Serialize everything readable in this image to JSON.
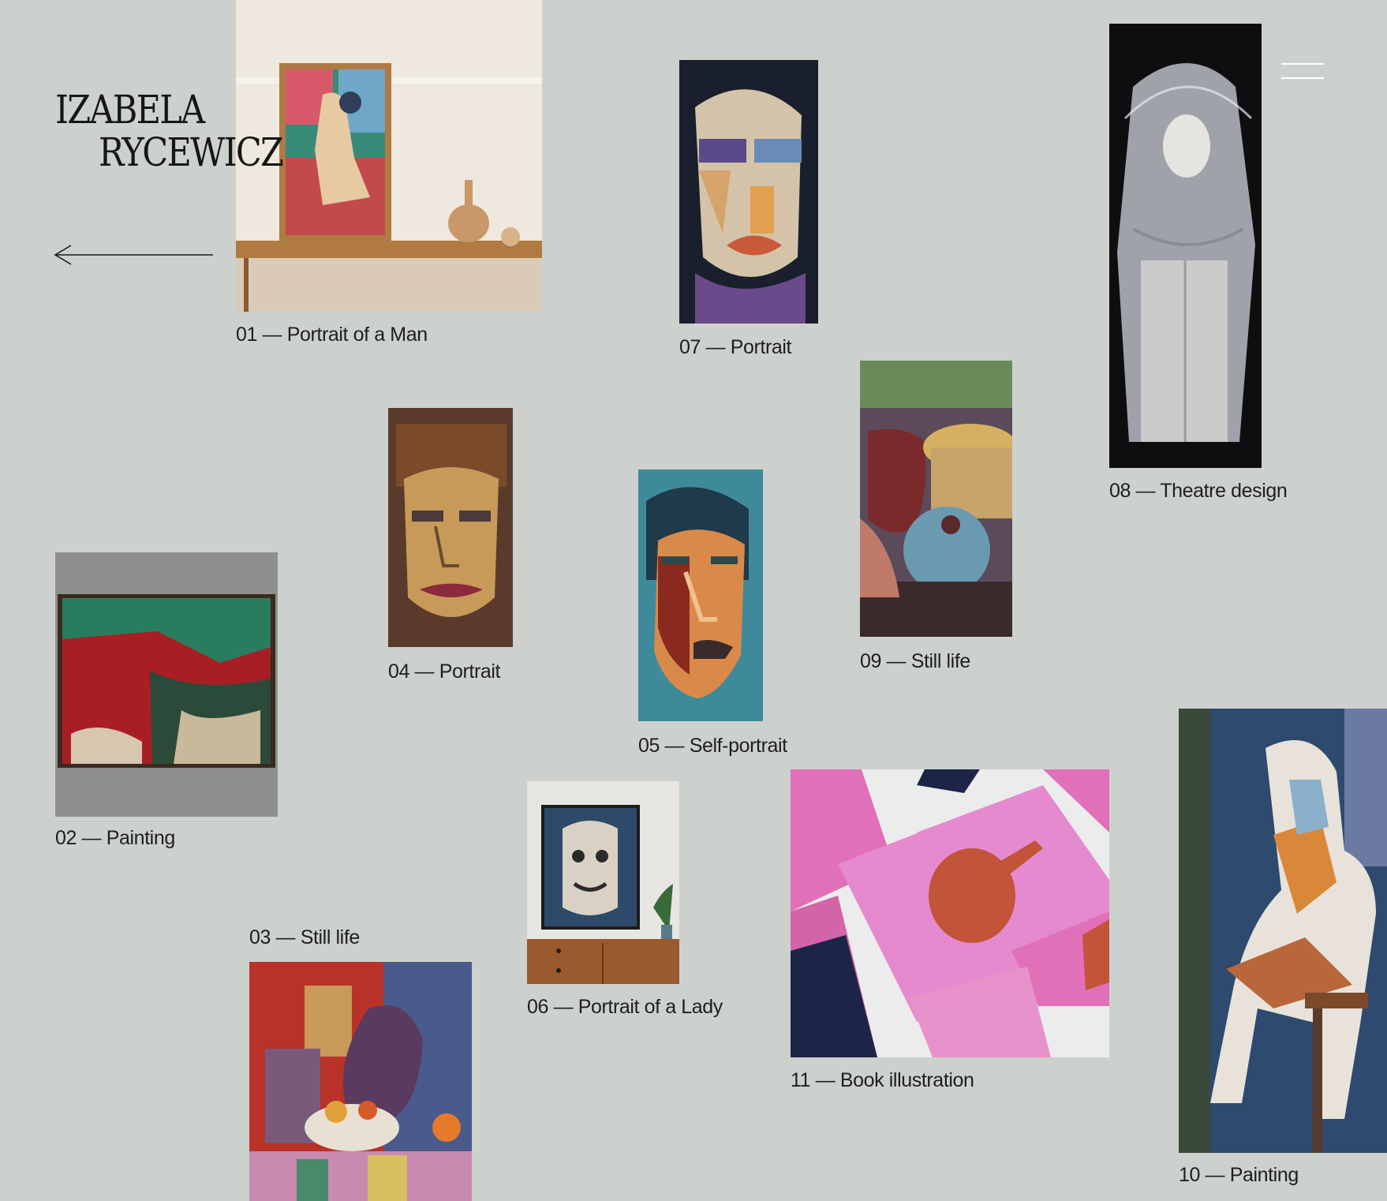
{
  "header": {
    "logo_line1": "IZABELA",
    "logo_line2": "RYCEWICZ",
    "back_icon": "arrow-left-icon",
    "menu_icon": "hamburger-menu-icon"
  },
  "colors": {
    "background": "#cdd1cd",
    "text": "#1c1c1c",
    "menu_bars": "#ffffff"
  },
  "works": [
    {
      "caption": "01 — Portrait of a Man"
    },
    {
      "caption": "02 — Painting"
    },
    {
      "caption": "03 — Still life"
    },
    {
      "caption": "04 — Portrait"
    },
    {
      "caption": "05 — Self-portrait"
    },
    {
      "caption": "06 — Portrait of a Lady"
    },
    {
      "caption": "07 — Portrait"
    },
    {
      "caption": "08 — Theatre design"
    },
    {
      "caption": "09 — Still life"
    },
    {
      "caption": "10 — Painting"
    },
    {
      "caption": "11 — Book illustration"
    }
  ]
}
